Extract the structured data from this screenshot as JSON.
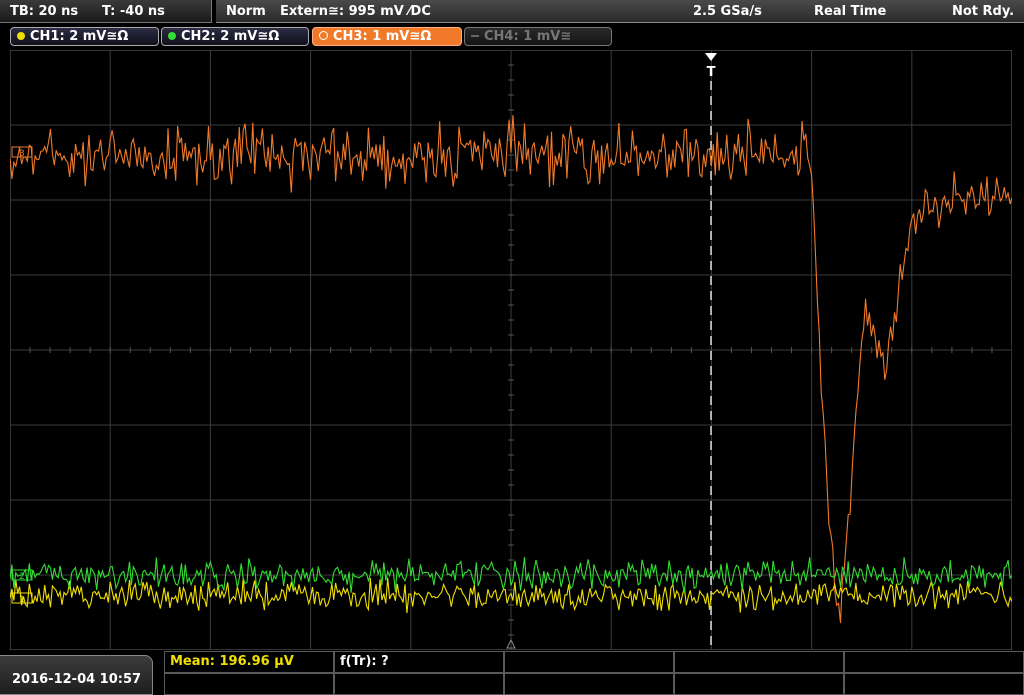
{
  "status": {
    "timebase": "TB: 20 ns",
    "trigger_time": "T: -40 ns",
    "mode": "Norm",
    "trigger_source": "Extern≅: 995 mV ⁄DC",
    "sample_rate": "2.5 GSa/s",
    "acq_mode": "Real Time",
    "ready_state": "Not Rdy."
  },
  "channels": [
    {
      "label": "CH1: 2 mV≅Ω",
      "color": "#f0e000",
      "active": true
    },
    {
      "label": "CH2: 2 mV≅Ω",
      "color": "#33dd33",
      "active": true
    },
    {
      "label": "CH3: 1 mV≅Ω",
      "color": "#f07a2a",
      "active": true,
      "selected": true
    },
    {
      "label": "CH4: 1 mV≅",
      "color": "#888888",
      "active": false
    }
  ],
  "markers": {
    "trigger_top": "T",
    "ch3_ref": "3",
    "ch2_ref": "2",
    "ch1_ref": "1"
  },
  "measurements": {
    "mean": "Mean: 196.96 µV",
    "ftr": "f(Tr): ?"
  },
  "datetime": "2016-12-04 10:57",
  "colors": {
    "ch1": "#f0e000",
    "ch2": "#33dd33",
    "ch3": "#f07a2a",
    "grid": "#404040",
    "trigger_line": "#ffffff",
    "mean_text": "#f0e000"
  }
}
